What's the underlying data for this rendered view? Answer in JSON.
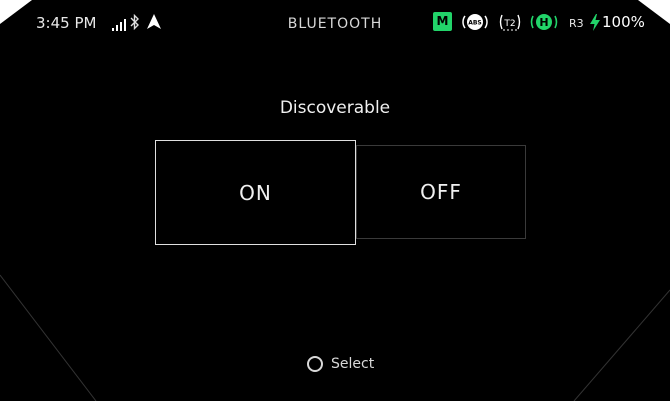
{
  "status_bar": {
    "time": "3:45 PM",
    "screen_title": "BLUETOOTH",
    "mode_badge": "M",
    "abs_label": "ABS",
    "traction_label": "T2",
    "heat_label": "H",
    "ride_mode": "R3",
    "battery": "100%",
    "icons": [
      "signal-icon",
      "bluetooth-icon",
      "navigation-arrow-icon",
      "abs-icon",
      "traction-control-icon",
      "heated-grips-icon",
      "charging-bolt-icon"
    ],
    "accent_color": "#22d46a"
  },
  "main": {
    "heading": "Discoverable",
    "options": [
      {
        "label": "ON",
        "selected": true
      },
      {
        "label": "OFF",
        "selected": false
      }
    ]
  },
  "footer": {
    "hint": "Select"
  }
}
